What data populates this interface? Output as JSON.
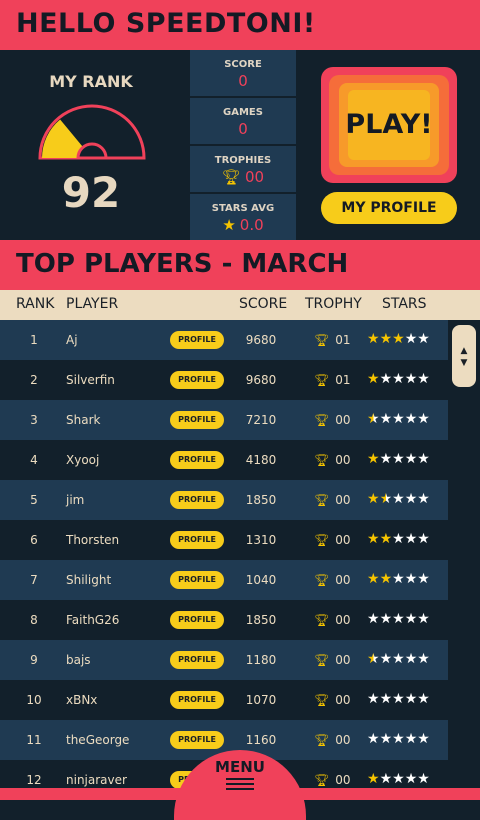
{
  "header": {
    "title": "HELLO SPEEDTONI!"
  },
  "rank": {
    "label": "MY RANK",
    "value": "92",
    "gauge_fraction": 0.28
  },
  "stats": [
    {
      "label": "SCORE",
      "value": "0",
      "icon": ""
    },
    {
      "label": "GAMES",
      "value": "0",
      "icon": ""
    },
    {
      "label": "TROPHIES",
      "value": "00",
      "icon": "trophy-icon"
    },
    {
      "label": "STARS AVG",
      "value": "0.0",
      "icon": "star-icon"
    }
  ],
  "play_button": {
    "label": "PLAY!"
  },
  "my_profile_button": {
    "label": "MY PROFILE"
  },
  "leaderboard": {
    "title": "TOP PLAYERS - MARCH",
    "columns": {
      "rank": "RANK",
      "player": "PLAYER",
      "score": "SCORE",
      "trophy": "TROPHY",
      "stars": "STARS"
    },
    "profile_label": "PROFILE",
    "rows": [
      {
        "rank": "1",
        "player": "Aj",
        "score": "9680",
        "trophies": "01",
        "stars": 3
      },
      {
        "rank": "2",
        "player": "Silverfin",
        "score": "9680",
        "trophies": "01",
        "stars": 1
      },
      {
        "rank": "3",
        "player": "Shark",
        "score": "7210",
        "trophies": "00",
        "stars": 0.5
      },
      {
        "rank": "4",
        "player": "Xyooj",
        "score": "4180",
        "trophies": "00",
        "stars": 1
      },
      {
        "rank": "5",
        "player": "jim",
        "score": "1850",
        "trophies": "00",
        "stars": 1.5
      },
      {
        "rank": "6",
        "player": "Thorsten",
        "score": "1310",
        "trophies": "00",
        "stars": 2
      },
      {
        "rank": "7",
        "player": "Shilight",
        "score": "1040",
        "trophies": "00",
        "stars": 2
      },
      {
        "rank": "8",
        "player": "FaithG26",
        "score": "1850",
        "trophies": "00",
        "stars": 0
      },
      {
        "rank": "9",
        "player": "bajs",
        "score": "1180",
        "trophies": "00",
        "stars": 0.5
      },
      {
        "rank": "10",
        "player": "xBNx",
        "score": "1070",
        "trophies": "00",
        "stars": 0
      },
      {
        "rank": "11",
        "player": "theGeorge",
        "score": "1160",
        "trophies": "00",
        "stars": 0
      },
      {
        "rank": "12",
        "player": "ninjaraver",
        "score": "",
        "trophies": "00",
        "stars": 1
      }
    ]
  },
  "menu": {
    "label": "MENU"
  },
  "colors": {
    "accent_red": "#f0415a",
    "navy": "#12202b",
    "row_blue": "#1f3a52",
    "yellow": "#f7cc1a",
    "cream": "#ecdcc0"
  }
}
